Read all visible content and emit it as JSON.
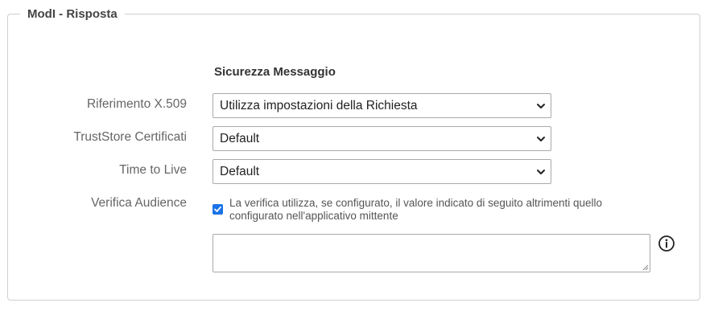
{
  "fieldset": {
    "legend": "ModI - Risposta"
  },
  "section": {
    "title": "Sicurezza Messaggio"
  },
  "fields": {
    "riferimento": {
      "label": "Riferimento X.509",
      "value": "Utilizza impostazioni della Richiesta"
    },
    "truststore": {
      "label": "TrustStore Certificati",
      "value": "Default"
    },
    "ttl": {
      "label": "Time to Live",
      "value": "Default"
    },
    "audience": {
      "label": "Verifica Audience",
      "checked": true,
      "description_line1": "La verifica utilizza, se configurato, il valore indicato di seguito altrimenti quello",
      "description_line2": "configurato nell'applicativo mittente",
      "textarea_value": ""
    }
  },
  "icons": {
    "dropdown": "chevron-down-icon",
    "info": "info-icon",
    "check": "check-icon"
  },
  "colors": {
    "checkbox_accent": "#1a73e8",
    "border": "#cfcfcf",
    "label": "#666666"
  }
}
